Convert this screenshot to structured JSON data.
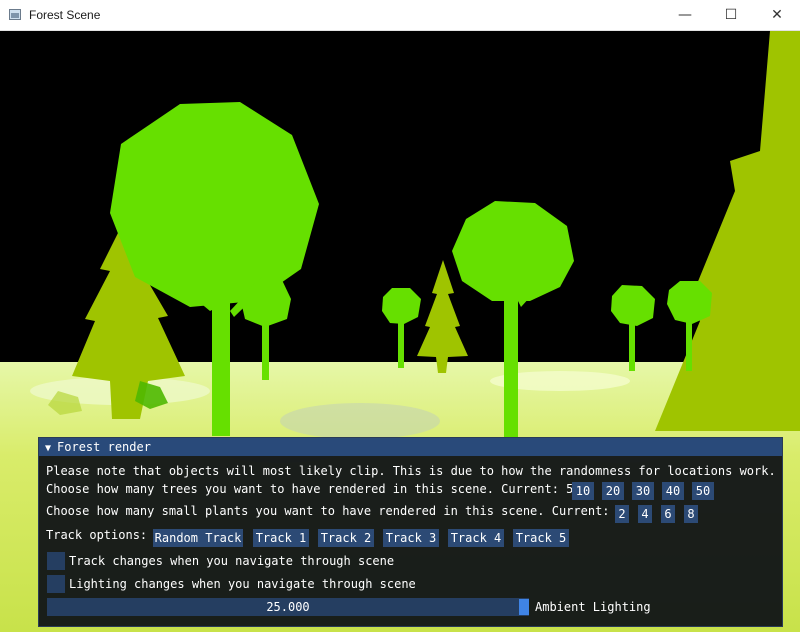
{
  "window": {
    "title": "Forest Scene",
    "minimize_glyph": "—",
    "maximize_glyph": "☐",
    "close_glyph": "✕"
  },
  "scene": {
    "sky_color": "#000000",
    "leaf_color": "#66e000",
    "pine_color": "#9fc400"
  },
  "panel": {
    "header_arrow": "▼",
    "title": "Forest render",
    "note": "Please note that objects will most likely clip. This is due to how the randomness for locations work.",
    "trees": {
      "label": "Choose how many trees you want to have rendered in this scene. Current: 50",
      "options": [
        "10",
        "20",
        "30",
        "40",
        "50"
      ]
    },
    "plants": {
      "label": "Choose how many small plants you want to have rendered in this scene. Current: 6",
      "options": [
        "2",
        "4",
        "6",
        "8"
      ]
    },
    "tracks": {
      "label": "Track options:",
      "options": [
        "Random Track",
        "Track 1",
        "Track 2",
        "Track 3",
        "Track 4",
        "Track 5"
      ]
    },
    "checkboxes": [
      {
        "label": "Track changes when you navigate through scene",
        "checked": false
      },
      {
        "label": "Lighting changes when you navigate through scene",
        "checked": false
      }
    ],
    "slider": {
      "value": "25.000",
      "label": "Ambient Lighting",
      "fraction": 1.0
    },
    "accent_color": "#3f84e5"
  }
}
